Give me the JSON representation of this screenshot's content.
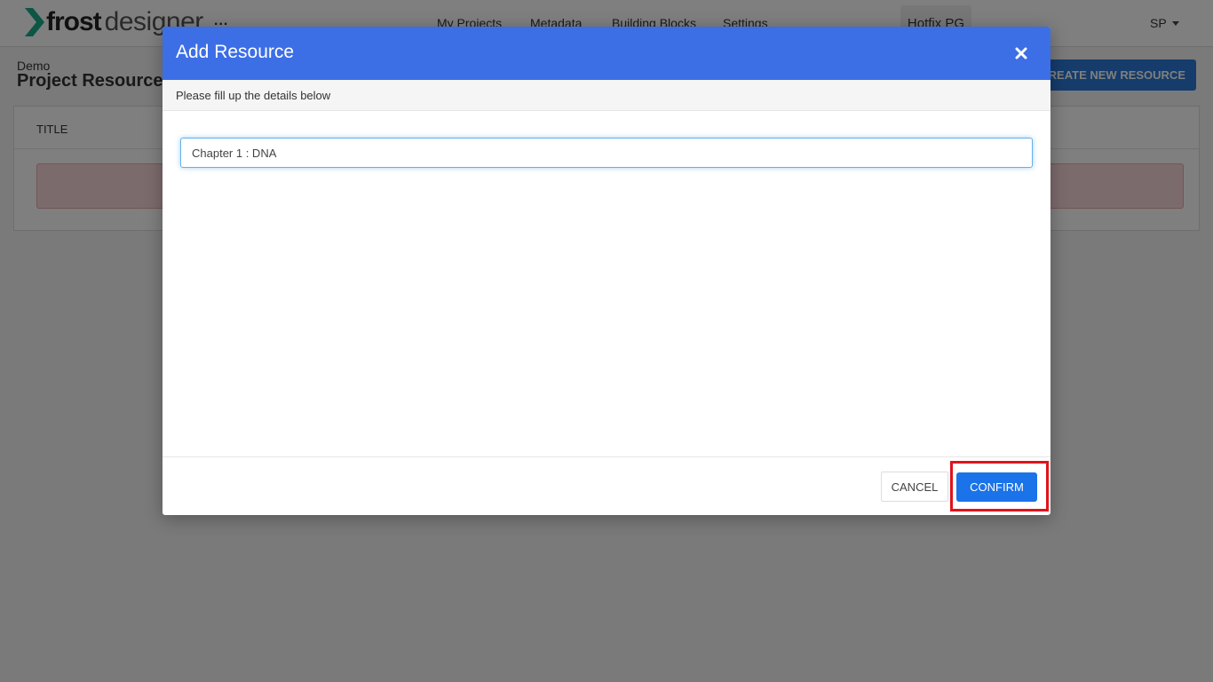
{
  "app": {
    "logo_bold": "frost",
    "logo_light": "designer",
    "more_label": "...",
    "accent_color": "#3c6ee6"
  },
  "nav": {
    "items": [
      {
        "label": "My Projects"
      },
      {
        "label": "Metadata"
      },
      {
        "label": "Building Blocks"
      },
      {
        "label": "Settings"
      }
    ],
    "project_name": "Hotfix PG",
    "user_initials": "SP"
  },
  "page": {
    "breadcrumb": "Demo",
    "title": "Project Resources",
    "create_button": "CREATE NEW RESOURCE",
    "table_header_title": "TITLE"
  },
  "modal": {
    "title": "Add Resource",
    "subtitle": "Please fill up the details below",
    "input_value": "Chapter 1 : DNA",
    "cancel_label": "CANCEL",
    "confirm_label": "CONFIRM"
  }
}
